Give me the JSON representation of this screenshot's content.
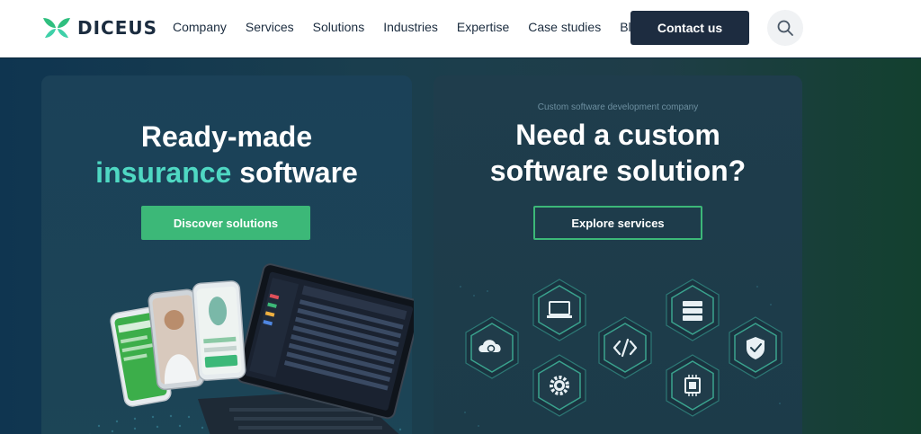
{
  "header": {
    "logo_text": "DICEUS",
    "nav": [
      "Company",
      "Services",
      "Solutions",
      "Industries",
      "Expertise",
      "Case studies",
      "Blog"
    ],
    "contact_label": "Contact us",
    "search_icon": "search-icon"
  },
  "hero": {
    "left": {
      "title_line1": "Ready-made",
      "title_accent": "insurance",
      "title_rest": " software",
      "button_label": "Discover solutions"
    },
    "right": {
      "eyebrow": "Custom software development company",
      "title_line1": "Need a custom",
      "title_line2": "software solution?",
      "button_label": "Explore services",
      "hex_icons": [
        "cloud-sync-icon",
        "laptop-icon",
        "gear-icon",
        "code-icon",
        "server-icon",
        "chip-icon",
        "shield-check-icon"
      ]
    }
  },
  "colors": {
    "brand_green": "#3cb878",
    "accent_teal": "#4fd8c3",
    "navy": "#1d2c40"
  }
}
